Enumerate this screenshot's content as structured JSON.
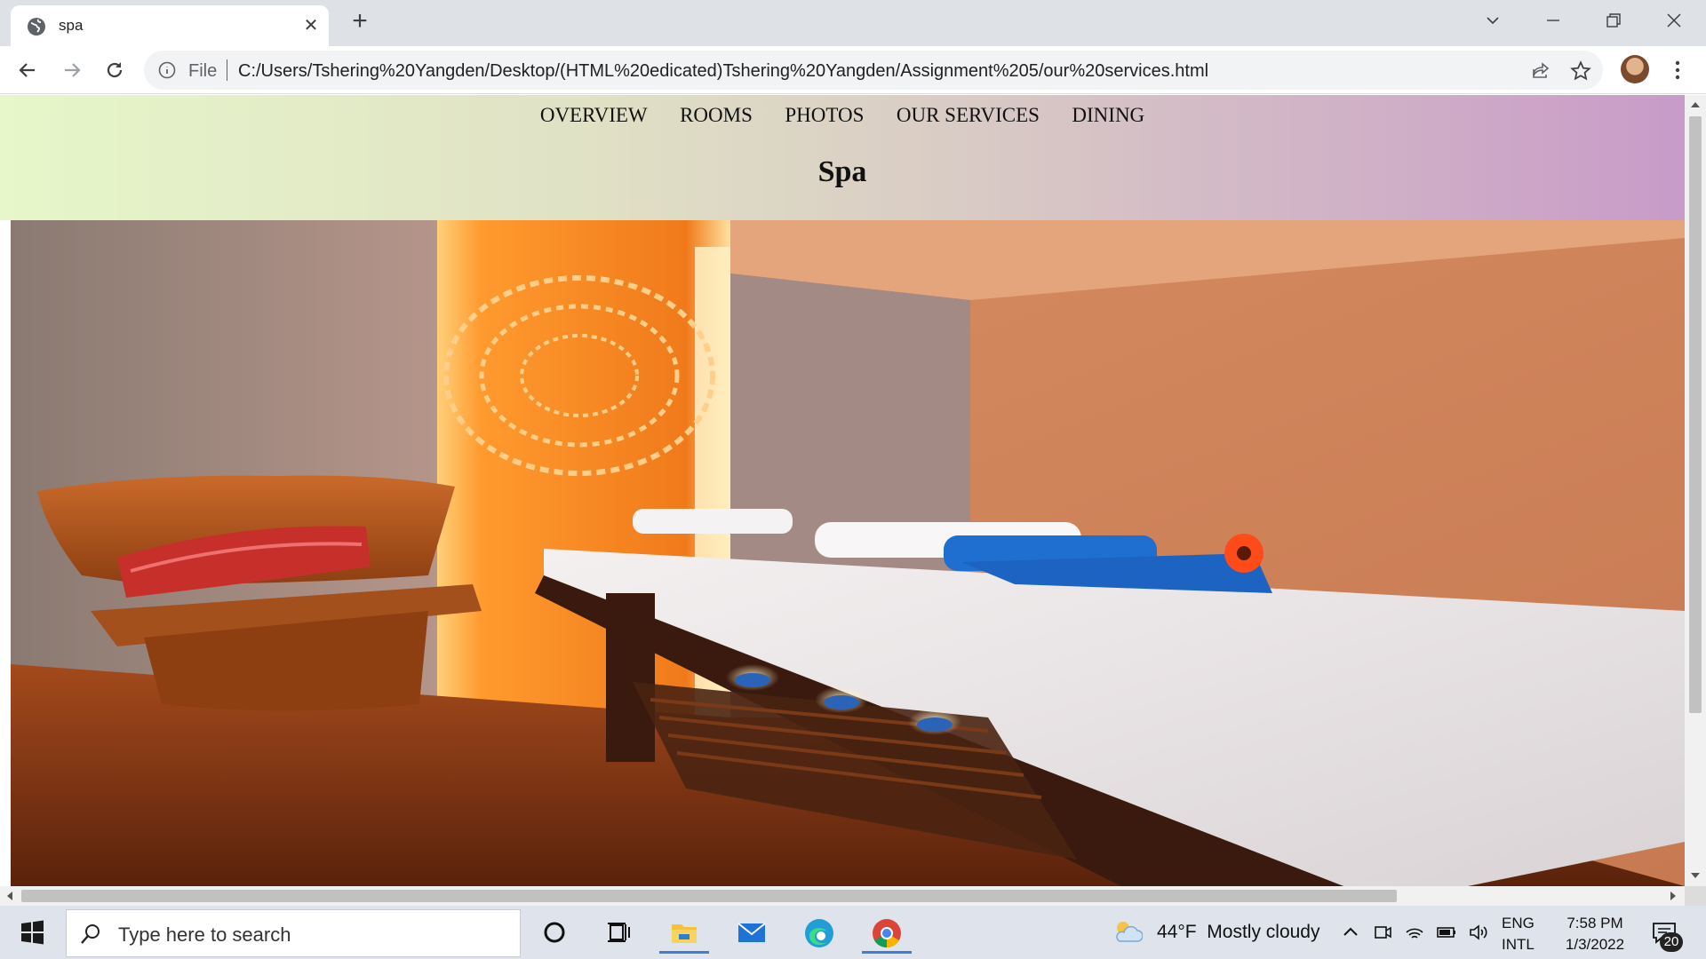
{
  "browser": {
    "tab_title": "spa",
    "address_scheme": "File",
    "address_url": "C:/Users/Tshering%20Yangden/Desktop/(HTML%20edicated)Tshering%20Yangden/Assignment%205/our%20services.html"
  },
  "page": {
    "nav": [
      "OVERVIEW",
      "ROOMS",
      "PHOTOS",
      "OUR SERVICES",
      "DINING"
    ],
    "title": "Spa",
    "header_gradient": [
      "#e6f7c9",
      "#c89bc8"
    ]
  },
  "taskbar": {
    "search_placeholder": "Type here to search",
    "weather_temp": "44°F",
    "weather_desc": "Mostly cloudy",
    "lang_line1": "ENG",
    "lang_line2": "INTL",
    "time": "7:58 PM",
    "date": "1/3/2022",
    "notification_count": "20"
  },
  "icons": [
    "globe-icon",
    "close-icon",
    "plus-icon",
    "chevron-down-icon",
    "minimize-icon",
    "restore-icon",
    "back-icon",
    "forward-icon",
    "reload-icon",
    "info-icon",
    "share-icon",
    "star-icon",
    "kebab-menu-icon",
    "windows-icon",
    "search-icon",
    "cortana-icon",
    "task-view-icon",
    "file-explorer-icon",
    "mail-icon",
    "edge-icon",
    "chrome-icon",
    "cloud-icon",
    "chevron-up-icon",
    "meet-now-icon",
    "wifi-icon",
    "battery-icon",
    "volume-icon",
    "notification-icon"
  ]
}
